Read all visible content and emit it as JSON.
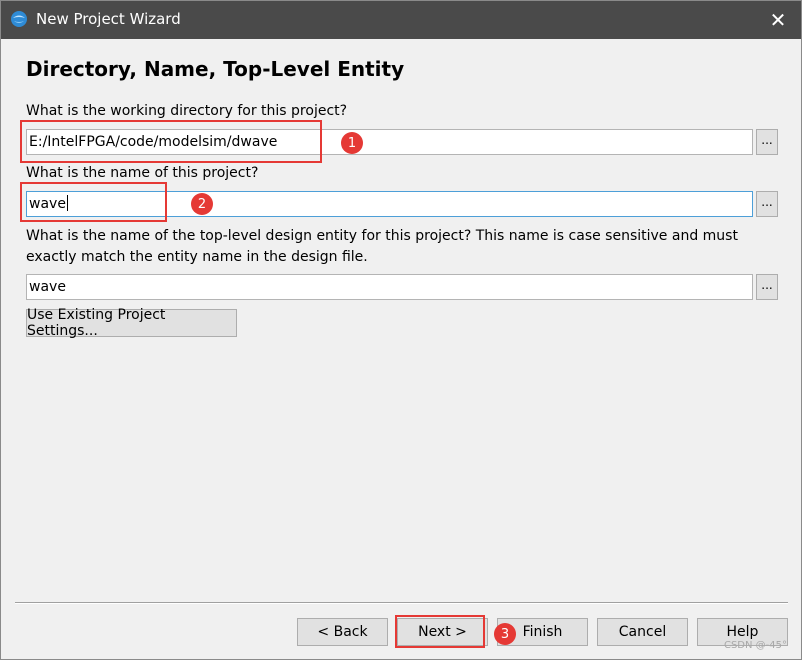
{
  "window": {
    "title": "New Project Wizard",
    "close_symbol": "✕"
  },
  "page": {
    "heading": "Directory, Name, Top-Level Entity"
  },
  "directory": {
    "label": "What is the working directory for this project?",
    "value": "E:/IntelFPGA/code/modelsim/dwave",
    "browse_label": "..."
  },
  "project_name": {
    "label": "What is the name of this project?",
    "value": "wave",
    "browse_label": "..."
  },
  "top_level": {
    "label": "What is the name of the top-level design entity for this project? This name is case sensitive and must exactly match the entity name in the design file.",
    "value": "wave",
    "browse_label": "..."
  },
  "use_existing_button": "Use Existing Project Settings...",
  "footer": {
    "back": "< Back",
    "next": "Next >",
    "finish": "Finish",
    "cancel": "Cancel",
    "help": "Help"
  },
  "annotations": {
    "badge_1": "1",
    "badge_2": "2",
    "badge_3": "3",
    "color": "#e53935"
  },
  "watermark": "CSDN @-45°",
  "colors": {
    "titlebar": "#4a4a4a",
    "focus_border": "#4d9fd8",
    "annotation_red": "#e53935"
  },
  "icons": {
    "app": "quartus-app-icon",
    "close": "close-icon"
  }
}
